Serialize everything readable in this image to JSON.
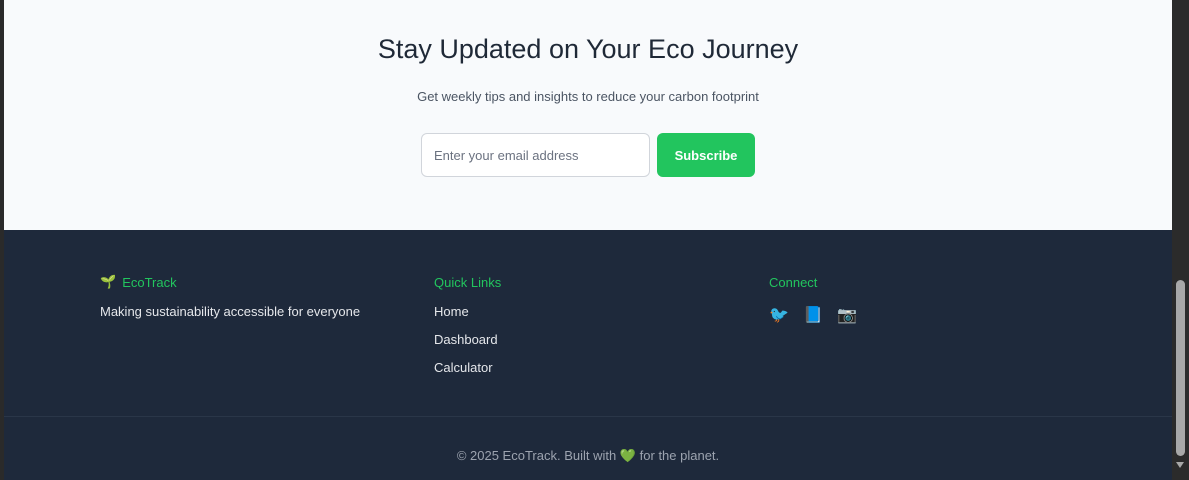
{
  "newsletter": {
    "title": "Stay Updated on Your Eco Journey",
    "subtitle": "Get weekly tips and insights to reduce your carbon footprint",
    "email_placeholder": "Enter your email address",
    "email_value": "",
    "subscribe_label": "Subscribe"
  },
  "footer": {
    "brand": {
      "icon": "seedling-icon",
      "emoji": "🌱",
      "name": "EcoTrack",
      "tagline": "Making sustainability accessible for everyone"
    },
    "quick_links": {
      "heading": "Quick Links",
      "items": [
        "Home",
        "Dashboard",
        "Calculator"
      ]
    },
    "connect": {
      "heading": "Connect",
      "icons": [
        {
          "name": "bird-icon",
          "glyph": "🐦"
        },
        {
          "name": "book-icon",
          "glyph": "📘"
        },
        {
          "name": "camera-icon",
          "glyph": "📷"
        }
      ]
    },
    "copyright_prefix": "© 2025 EcoTrack. Built with",
    "copyright_suffix": "for the planet.",
    "heart_glyph": "💚"
  },
  "colors": {
    "accent": "#22c55e",
    "footer_bg": "#1e293b",
    "section_bg": "#f8fafc"
  }
}
